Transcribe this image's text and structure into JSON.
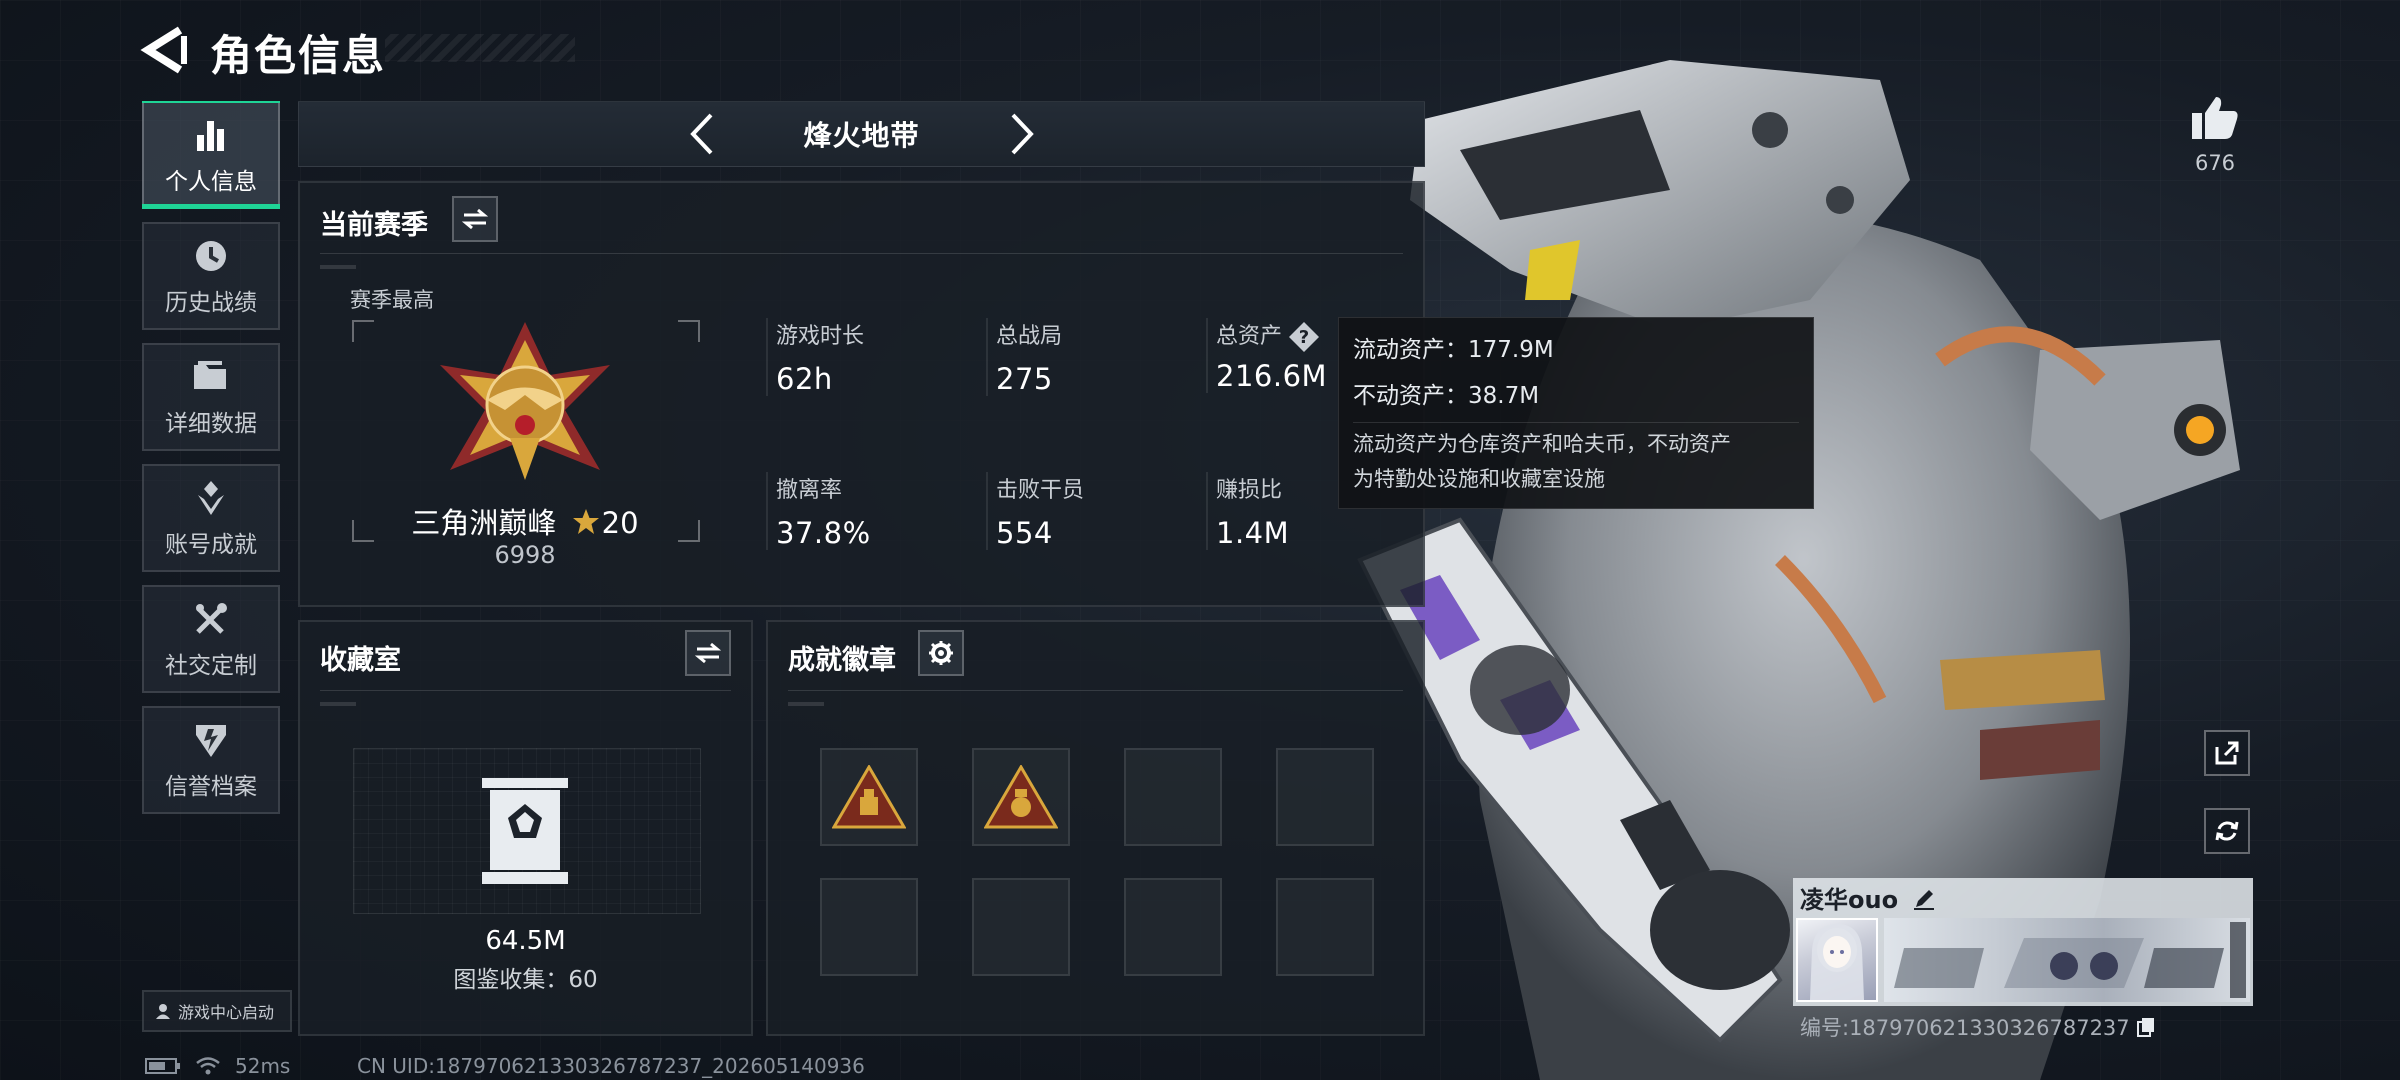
{
  "header": {
    "title": "角色信息"
  },
  "sidebar": {
    "items": [
      {
        "label": "个人信息",
        "icon": "bar-chart-icon",
        "active": true
      },
      {
        "label": "历史战绩",
        "icon": "history-icon"
      },
      {
        "label": "详细数据",
        "icon": "folder-icon"
      },
      {
        "label": "账号成就",
        "icon": "achievement-icon"
      },
      {
        "label": "社交定制",
        "icon": "tools-icon"
      },
      {
        "label": "信誉档案",
        "icon": "shield-icon"
      }
    ],
    "game_center": "游戏中心启动"
  },
  "mode_bar": {
    "title": "烽火地带"
  },
  "season": {
    "title": "当前赛季",
    "best_label": "赛季最高",
    "rank_name": "三角洲巅峰",
    "rank_stars": "20",
    "rank_score": "6998",
    "stats": [
      {
        "label": "游戏时长",
        "value": "62h"
      },
      {
        "label": "总战局",
        "value": "275"
      },
      {
        "label": "总资产",
        "value": "216.6M",
        "help": true
      },
      {
        "label": "撤离率",
        "value": "37.8%"
      },
      {
        "label": "击败干员",
        "value": "554"
      },
      {
        "label": "赚损比",
        "value": "1.4M"
      }
    ]
  },
  "tooltip": {
    "liquid": "流动资产：177.9M",
    "fixed": "不动资产：38.7M",
    "desc_line1": "流动资产为仓库资产和哈夫币，不动资产",
    "desc_line2": "为特勤处设施和收藏室设施"
  },
  "collection": {
    "title": "收藏室",
    "value": "64.5M",
    "count": "图鉴收集：60"
  },
  "badges": {
    "title": "成就徽章",
    "slots": [
      {
        "filled": true
      },
      {
        "filled": true
      },
      {
        "filled": false
      },
      {
        "filled": false
      },
      {
        "filled": false
      },
      {
        "filled": false
      },
      {
        "filled": false
      },
      {
        "filled": false
      }
    ]
  },
  "like": {
    "count": "676"
  },
  "profile": {
    "name": "凌华ouo",
    "id_label": "编号:1879706213303267872​37",
    "id": "编号:187970621330326787237"
  },
  "status": {
    "ping": "52ms",
    "uid": "CN UID:187970621330326787237_202605140936"
  },
  "colors": {
    "accent": "#1fd496",
    "gold": "#d9a73c",
    "background": "#161c25"
  }
}
